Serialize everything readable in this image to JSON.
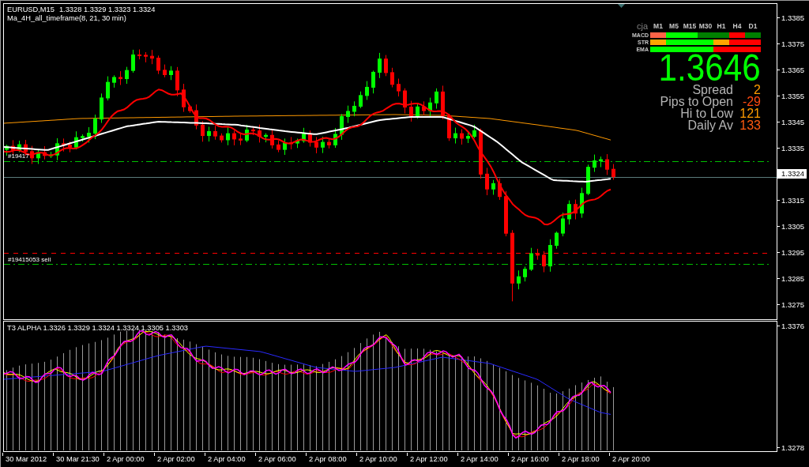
{
  "chart": {
    "symbol": "EURUSD,M15",
    "ohlc": "1.3328 1.3329 1.3323 1.3324",
    "indicator": "Ma_4H_all_timeframe(8, 21, 30 min)",
    "order_labels": [
      "#19417",
      "#19415053 sell"
    ]
  },
  "signal_panel": {
    "brand": "cja",
    "timeframes": [
      "M1",
      "M5",
      "M15",
      "M30",
      "H1",
      "H4",
      "D1"
    ],
    "rows": [
      {
        "label": "MACD",
        "cells": [
          {
            "color": "#ff6347"
          },
          {
            "color": "#00ff00"
          },
          {
            "color": "#00ff00"
          },
          {
            "color": "#008000"
          },
          {
            "color": "#008000"
          },
          {
            "color": "#ff0000"
          },
          {
            "color": "#008000"
          }
        ]
      },
      {
        "label": "STR",
        "cells": [
          {
            "color": "#ffa500"
          },
          {
            "color": "#00ff00"
          },
          {
            "color": "#00ff00"
          },
          {
            "color": "#00ff00"
          },
          {
            "color": "#ffa500"
          },
          {
            "color": "#ff0000"
          },
          {
            "color": "#ff0000"
          }
        ]
      },
      {
        "label": "EMA",
        "cells": [
          {
            "color": "#00ff00"
          },
          {
            "color": "#00ff00"
          },
          {
            "color": "#00ff00"
          },
          {
            "color": "#00ff00"
          },
          {
            "color": "#ff0000"
          },
          {
            "color": "#ff0000"
          },
          {
            "color": "#ff0000"
          }
        ]
      }
    ],
    "price": "1.3646",
    "stats": [
      {
        "label": "Spread",
        "value": "2",
        "color": "#ff9c00"
      },
      {
        "label": "Pips to Open",
        "value": "-29",
        "color": "#ff4a10"
      },
      {
        "label": "Hi to Low",
        "value": "121",
        "color": "#ff9c00"
      },
      {
        "label": "Daily Av",
        "value": "133",
        "color": "#ff5a10"
      }
    ]
  },
  "price_axis": [
    {
      "label": "1.3385",
      "kind": "tick"
    },
    {
      "label": "1.3375",
      "kind": "tick"
    },
    {
      "label": "1.3365",
      "kind": "tick"
    },
    {
      "label": "1.3355",
      "kind": "tick"
    },
    {
      "label": "1.3345",
      "kind": "tick"
    },
    {
      "label": "1.3335",
      "kind": "tick"
    },
    {
      "label": "1.3324",
      "kind": "current"
    },
    {
      "label": "1.3315",
      "kind": "tick"
    },
    {
      "label": "1.3305",
      "kind": "tick"
    },
    {
      "label": "1.3295",
      "kind": "tick"
    },
    {
      "label": "1.3285",
      "kind": "tick"
    },
    {
      "label": "1.3275",
      "kind": "tick"
    }
  ],
  "subchart": {
    "title": "T3 ALPHA 1.3326 1.3329 1.3324 1.3324 1.3305 1.3303",
    "axis": [
      "1.3376",
      "1.3278"
    ]
  },
  "time_axis": [
    "30 Mar 2012",
    "30 Mar 21:30",
    "2 Apr 00:00",
    "2 Apr 02:00",
    "2 Apr 04:00",
    "2 Apr 06:00",
    "2 Apr 08:00",
    "2 Apr 10:00",
    "2 Apr 12:00",
    "2 Apr 14:00",
    "2 Apr 16:00",
    "2 Apr 18:00",
    "2 Apr 20:00"
  ]
}
